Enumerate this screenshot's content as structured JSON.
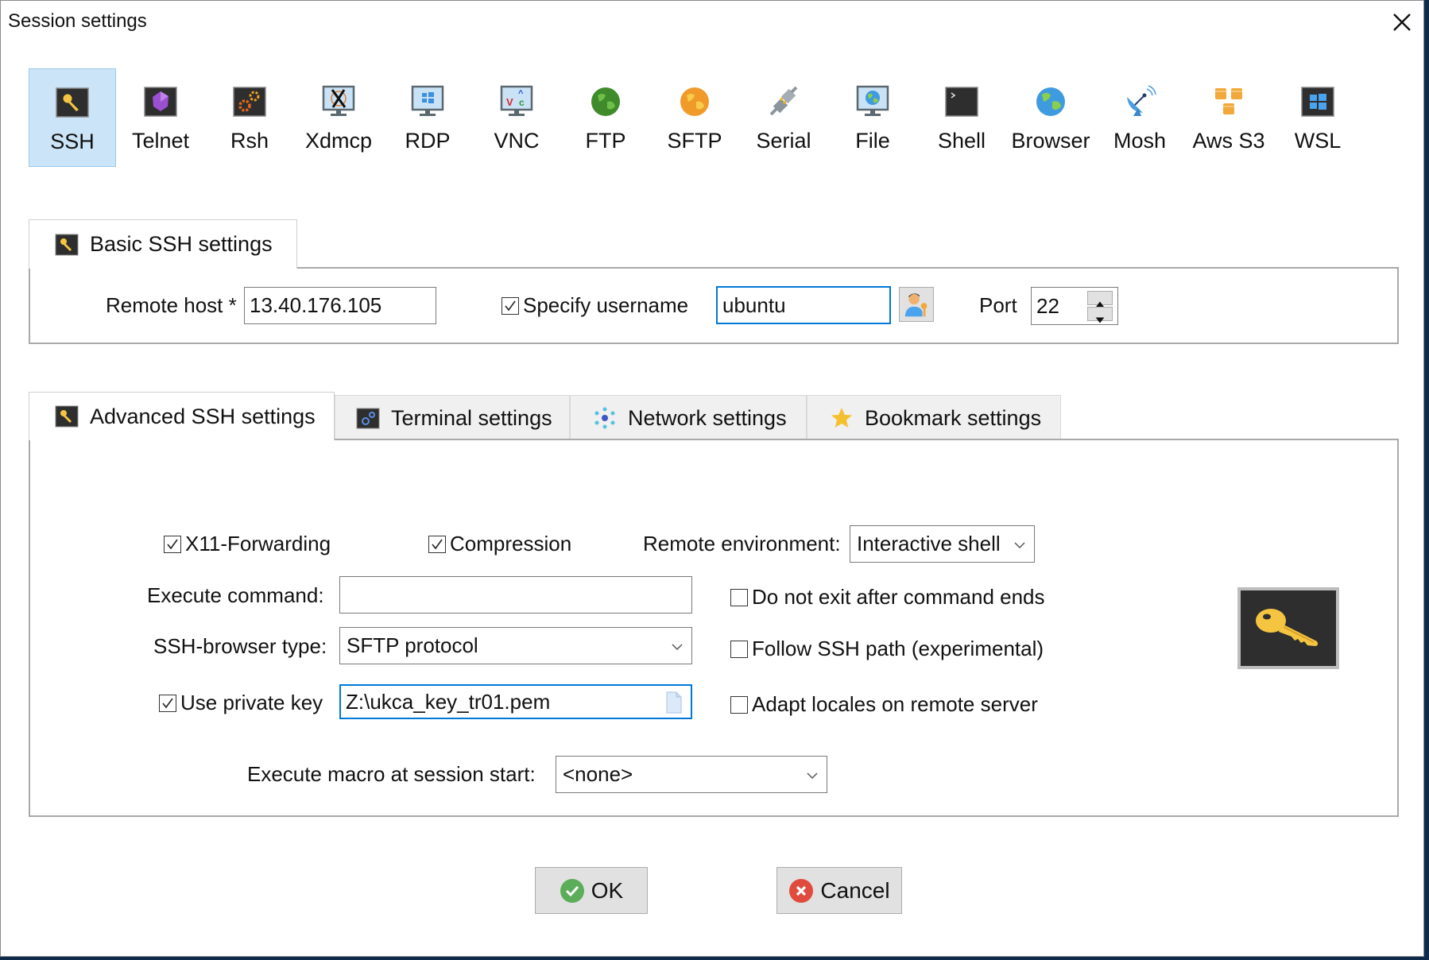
{
  "window": {
    "title": "Session settings",
    "close_icon": "close-icon"
  },
  "session_types": [
    {
      "label": "SSH",
      "icon": "ssh-key-icon",
      "selected": true
    },
    {
      "label": "Telnet",
      "icon": "telnet-gem-icon",
      "selected": false
    },
    {
      "label": "Rsh",
      "icon": "rsh-gears-icon",
      "selected": false
    },
    {
      "label": "Xdmcp",
      "icon": "xdmcp-monitor-icon",
      "selected": false
    },
    {
      "label": "RDP",
      "icon": "rdp-monitor-icon",
      "selected": false
    },
    {
      "label": "VNC",
      "icon": "vnc-monitor-icon",
      "selected": false
    },
    {
      "label": "FTP",
      "icon": "ftp-globe-icon",
      "selected": false
    },
    {
      "label": "SFTP",
      "icon": "sftp-globe-icon",
      "selected": false
    },
    {
      "label": "Serial",
      "icon": "serial-plug-icon",
      "selected": false
    },
    {
      "label": "File",
      "icon": "file-monitor-icon",
      "selected": false
    },
    {
      "label": "Shell",
      "icon": "shell-terminal-icon",
      "selected": false
    },
    {
      "label": "Browser",
      "icon": "browser-globe-icon",
      "selected": false
    },
    {
      "label": "Mosh",
      "icon": "mosh-satellite-icon",
      "selected": false
    },
    {
      "label": "Aws S3",
      "icon": "aws-s3-cubes-icon",
      "selected": false
    },
    {
      "label": "WSL",
      "icon": "wsl-windows-icon",
      "selected": false
    }
  ],
  "basic": {
    "tab_label": "Basic SSH settings",
    "remote_host_label": "Remote host *",
    "remote_host_value": "13.40.176.105",
    "specify_username_label": "Specify username",
    "specify_username_checked": true,
    "username_value": "ubuntu",
    "port_label": "Port",
    "port_value": "22"
  },
  "advanced_tabs": [
    {
      "label": "Advanced SSH settings",
      "icon": "ssh-key-icon",
      "active": true
    },
    {
      "label": "Terminal settings",
      "icon": "terminal-icon",
      "active": false
    },
    {
      "label": "Network settings",
      "icon": "network-icon",
      "active": false
    },
    {
      "label": "Bookmark settings",
      "icon": "star-icon",
      "active": false
    }
  ],
  "advanced": {
    "x11_forwarding_label": "X11-Forwarding",
    "x11_forwarding_checked": true,
    "compression_label": "Compression",
    "compression_checked": true,
    "remote_env_label": "Remote environment:",
    "remote_env_value": "Interactive shell",
    "execute_command_label": "Execute command:",
    "execute_command_value": "",
    "do_not_exit_label": "Do not exit after command ends",
    "do_not_exit_checked": false,
    "ssh_browser_label": "SSH-browser type:",
    "ssh_browser_value": "SFTP protocol",
    "follow_ssh_path_label": "Follow SSH path (experimental)",
    "follow_ssh_path_checked": false,
    "use_private_key_label": "Use private key",
    "use_private_key_checked": true,
    "private_key_value": "Z:\\ukca_key_tr01.pem",
    "adapt_locales_label": "Adapt locales on remote server",
    "adapt_locales_checked": false,
    "macro_label": "Execute macro at session start:",
    "macro_value": "<none>"
  },
  "buttons": {
    "ok_label": "OK",
    "cancel_label": "Cancel"
  },
  "colors": {
    "selection_bg": "#cce4f7",
    "focus_border": "#0078d7",
    "ok_green": "#5cad5a",
    "cancel_red": "#e04b3d",
    "key_yellow": "#f5c542"
  }
}
